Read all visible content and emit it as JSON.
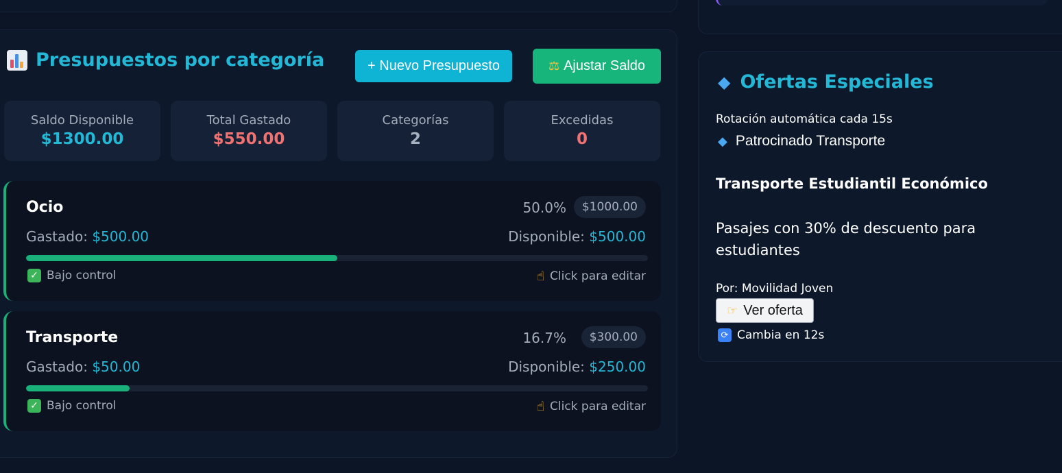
{
  "budget": {
    "title": "Presupuestos por categoría",
    "title_icon": "bar-chart-icon",
    "new_button": "+ Nuevo Presupuesto",
    "adjust_button": "Ajustar Saldo",
    "adjust_icon": "balance-scale-icon",
    "stats": [
      {
        "label": "Saldo Disponible",
        "value": "$1300.00"
      },
      {
        "label": "Total Gastado",
        "value": "$550.00"
      },
      {
        "label": "Categorías",
        "value": "2"
      },
      {
        "label": "Excedidas",
        "value": "0"
      }
    ],
    "categories": [
      {
        "name": "Ocio",
        "percent": "50.0%",
        "percent_value": 50.0,
        "limit": "$1000.00",
        "spent_label": "Gastado:",
        "spent": "$500.00",
        "available_label": "Disponible:",
        "available": "$500.00",
        "status": "Bajo control",
        "edit_hint": "Click para editar"
      },
      {
        "name": "Transporte",
        "percent": "16.7%",
        "percent_value": 16.7,
        "limit": "$300.00",
        "spent_label": "Gastado:",
        "spent": "$50.00",
        "available_label": "Disponible:",
        "available": "$250.00",
        "status": "Bajo control",
        "edit_hint": "Click para editar"
      }
    ]
  },
  "offers": {
    "title": "Ofertas Especiales",
    "title_icon": "gem-icon",
    "rotation": "Rotación automática cada 15s",
    "sponsor": "Patrocinado Transporte",
    "heading": "Transporte Estudiantil Económico",
    "description": "Pasajes con 30% de descuento para estudiantes",
    "by": "Por: Movilidad Joven",
    "button": "Ver oferta",
    "timer": "Cambia en 12s"
  },
  "colors": {
    "accent": "#22b8d6",
    "success": "#19b07a",
    "danger": "#f07171",
    "background": "#0b1526"
  }
}
